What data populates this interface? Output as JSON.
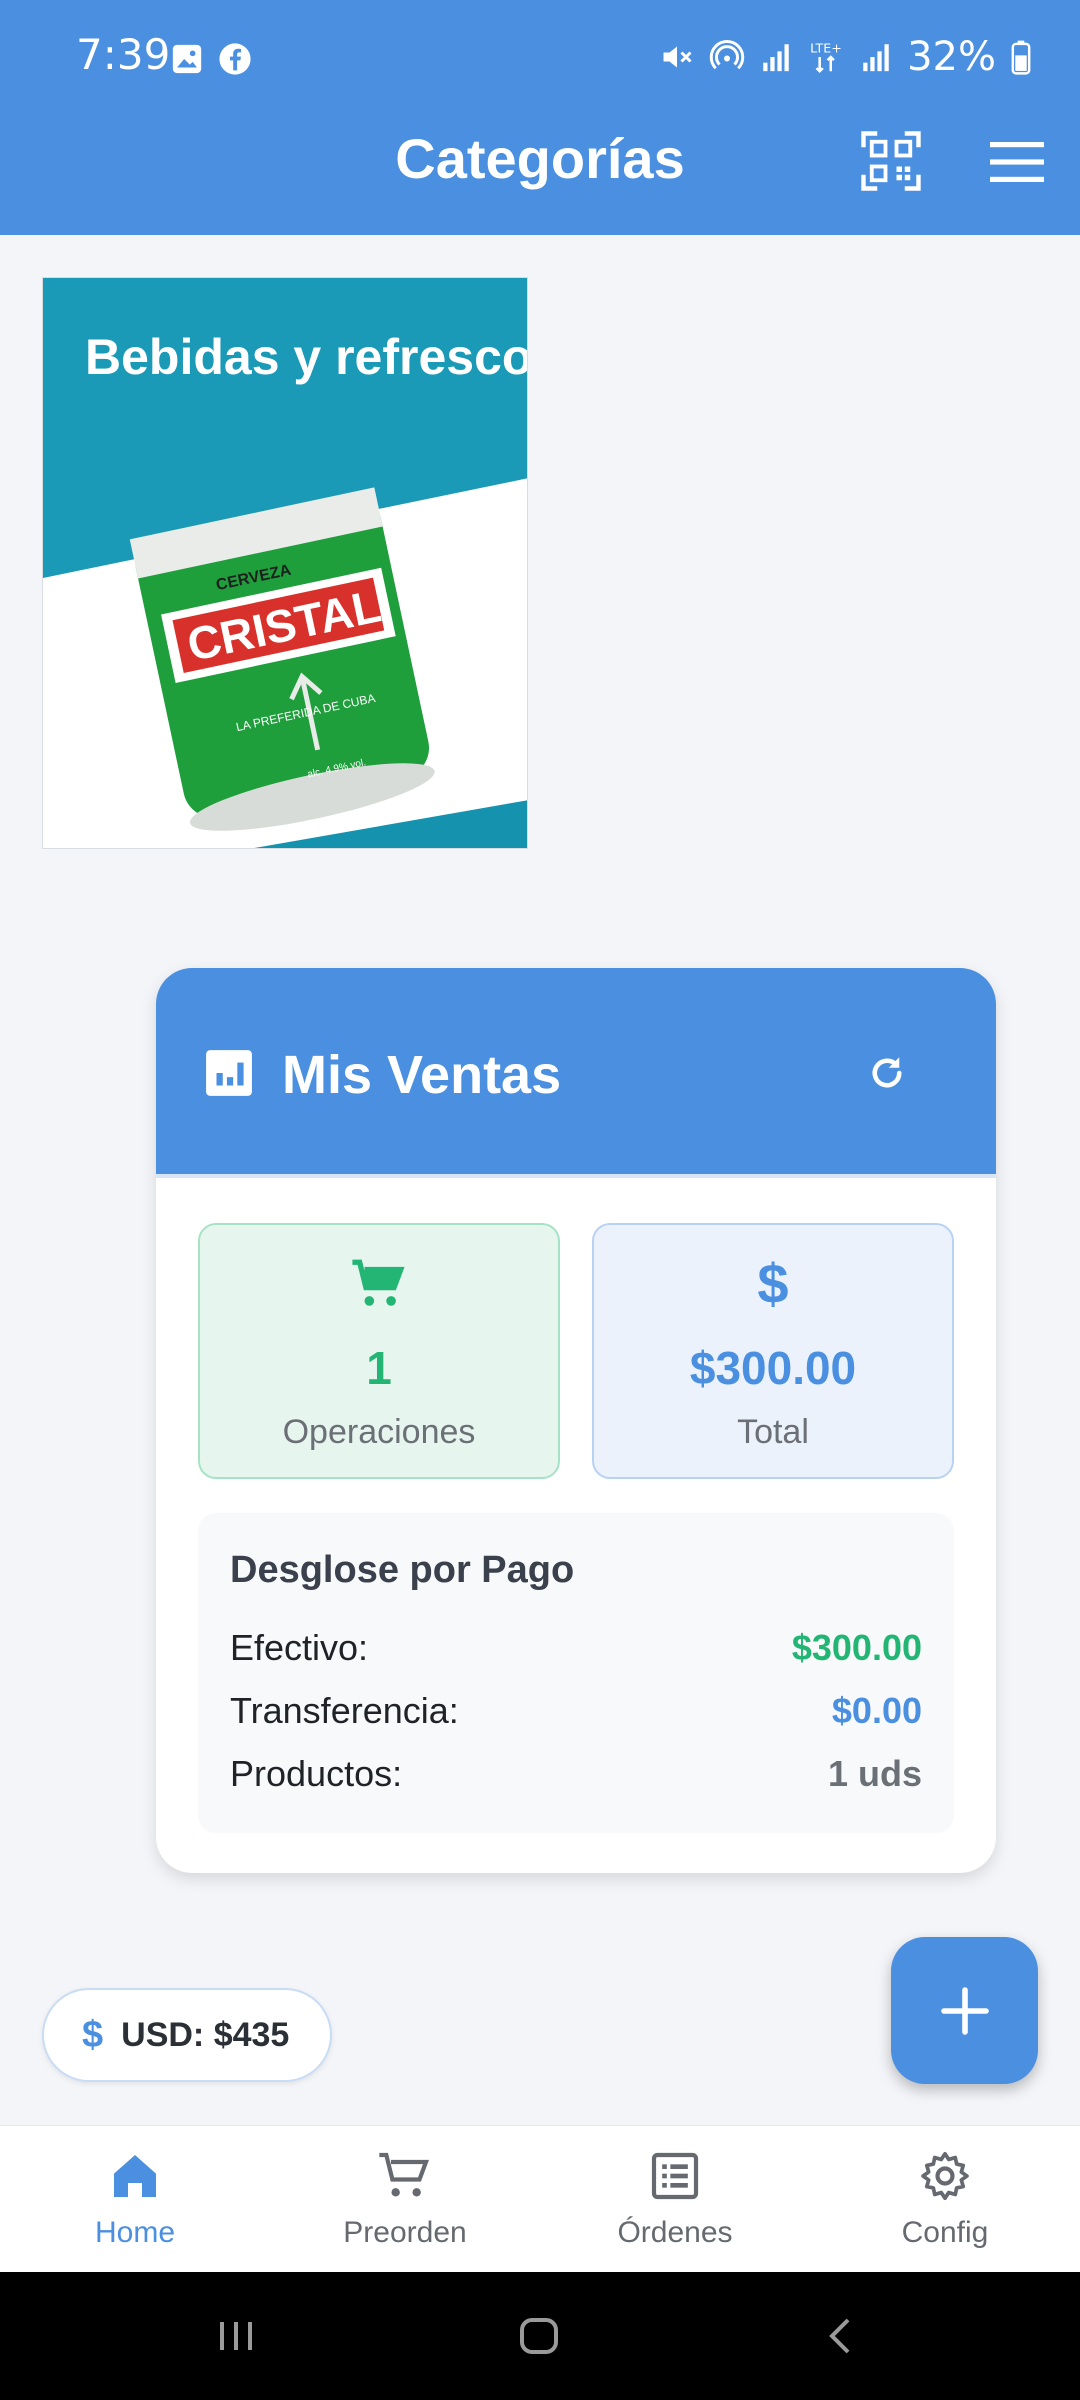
{
  "status_bar": {
    "time": "7:39",
    "battery": "32%",
    "left_icons": [
      "image-icon",
      "facebook-icon"
    ],
    "right_icons": [
      "mute-icon",
      "hotspot-icon",
      "signal-icon",
      "lte-icon",
      "signal-icon",
      "battery-icon"
    ]
  },
  "app_bar": {
    "title": "Categorías",
    "actions": [
      "qr-scan-icon",
      "menu-icon"
    ]
  },
  "categories": [
    {
      "title": "Bebidas y refresco",
      "image": "cristal-beer-can"
    }
  ],
  "sales": {
    "title": "Mis Ventas",
    "operations_value": "1",
    "operations_label": "Operaciones",
    "total_symbol": "$",
    "total_value": "$300.00",
    "total_label": "Total",
    "breakdown_title": "Desglose por Pago",
    "rows": [
      {
        "label": "Efectivo:",
        "value": "$300.00"
      },
      {
        "label": "Transferencia:",
        "value": "$0.00"
      },
      {
        "label": "Productos:",
        "value": "1 uds"
      }
    ]
  },
  "usd_pill": {
    "symbol": "$",
    "text": "USD: $435"
  },
  "bottom_nav": [
    {
      "label": "Home",
      "icon": "home-icon",
      "active": true
    },
    {
      "label": "Preorden",
      "icon": "cart-icon",
      "active": false
    },
    {
      "label": "Órdenes",
      "icon": "list-icon",
      "active": false
    },
    {
      "label": "Config",
      "icon": "gear-icon",
      "active": false
    }
  ],
  "colors": {
    "primary": "#4a8fe0",
    "success": "#22b573",
    "background": "#f3f5f9"
  }
}
